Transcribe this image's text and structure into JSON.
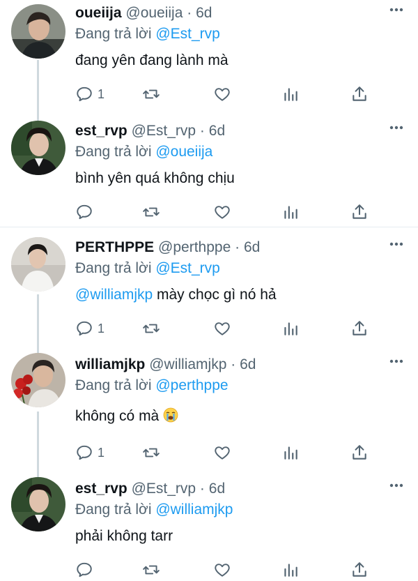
{
  "colors": {
    "accent": "#1d9bf0",
    "secondary_text": "#536471",
    "thread_line": "#cfd9de"
  },
  "tweets": [
    {
      "display_name": "oueiija",
      "handle": "@oueiija",
      "dot": "·",
      "time": "6d",
      "replying_prefix": "Đang trả lời",
      "replying_to": "@Est_rvp",
      "mention": "",
      "text": "đang yên đang lành mà",
      "reply_count": "1"
    },
    {
      "display_name": "est_rvp",
      "handle": "@Est_rvp",
      "dot": "·",
      "time": "6d",
      "replying_prefix": "Đang trả lời",
      "replying_to": "@oueiija",
      "mention": "",
      "text": "bình yên quá không chịu",
      "reply_count": ""
    },
    {
      "display_name": "PERTHPPE",
      "handle": "@perthppe",
      "dot": "·",
      "time": "6d",
      "replying_prefix": "Đang trả lời",
      "replying_to": "@Est_rvp",
      "mention": "@williamjkp",
      "text": " mày chọc gì nó hả",
      "reply_count": "1"
    },
    {
      "display_name": "williamjkp",
      "handle": "@williamjkp",
      "dot": "·",
      "time": "6d",
      "replying_prefix": "Đang trả lời",
      "replying_to": "@perthppe",
      "mention": "",
      "text": "không có mà ",
      "emoji": "loudly-crying-face",
      "reply_count": "1"
    },
    {
      "display_name": "est_rvp",
      "handle": "@Est_rvp",
      "dot": "·",
      "time": "6d",
      "replying_prefix": "Đang trả lời",
      "replying_to": "@williamjkp",
      "mention": "",
      "text": "phải không tarr",
      "reply_count": ""
    }
  ]
}
